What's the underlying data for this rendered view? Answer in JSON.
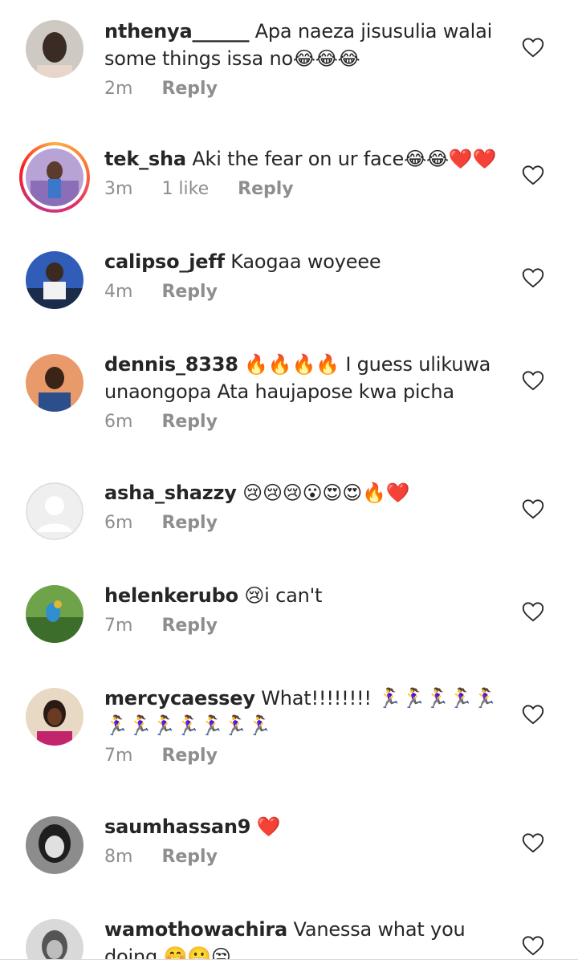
{
  "comments": [
    {
      "username": "nthenya______",
      "text": " Apa naeza jisusulia walai some things issa no😂😂😂",
      "time": "2m",
      "likes": "",
      "reply": "Reply"
    },
    {
      "username": "tek_sha",
      "text": " Aki the fear on ur face😂😂❤️❤️",
      "time": "3m",
      "likes": "1 like",
      "reply": "Reply"
    },
    {
      "username": "calipso_jeff",
      "text": " Kaogaa woyeee",
      "time": "4m",
      "likes": "",
      "reply": "Reply"
    },
    {
      "username": "dennis_8338",
      "text": " 🔥🔥🔥🔥 I guess ulikuwa unaongopa Ata haujapose kwa picha",
      "time": "6m",
      "likes": "",
      "reply": "Reply"
    },
    {
      "username": "asha_shazzy",
      "text": " 😢😢😢😮😍😍🔥❤️",
      "time": "6m",
      "likes": "",
      "reply": "Reply"
    },
    {
      "username": "helenkerubo",
      "text": " 😢i can't",
      "time": "7m",
      "likes": "",
      "reply": "Reply"
    },
    {
      "username": "mercycaessey",
      "text": " What!!!!!!!! 🏃‍♀️🏃‍♀️🏃‍♀️🏃‍♀️🏃‍♀️🏃‍♀️🏃‍♀️🏃‍♀️🏃‍♀️🏃‍♀️🏃‍♀️🏃‍♀️",
      "time": "7m",
      "likes": "",
      "reply": "Reply"
    },
    {
      "username": "saumhassan9",
      "text": " ❤️",
      "time": "8m",
      "likes": "",
      "reply": "Reply"
    },
    {
      "username": "wamothowachira",
      "text": " Vanessa what you doing 🤭😬😒",
      "time": "",
      "likes": "",
      "reply": ""
    }
  ],
  "icons": {
    "like": "heart-outline-icon"
  },
  "colors": {
    "username": "#262626",
    "meta": "#8e8e8e",
    "heart": "#262626"
  }
}
